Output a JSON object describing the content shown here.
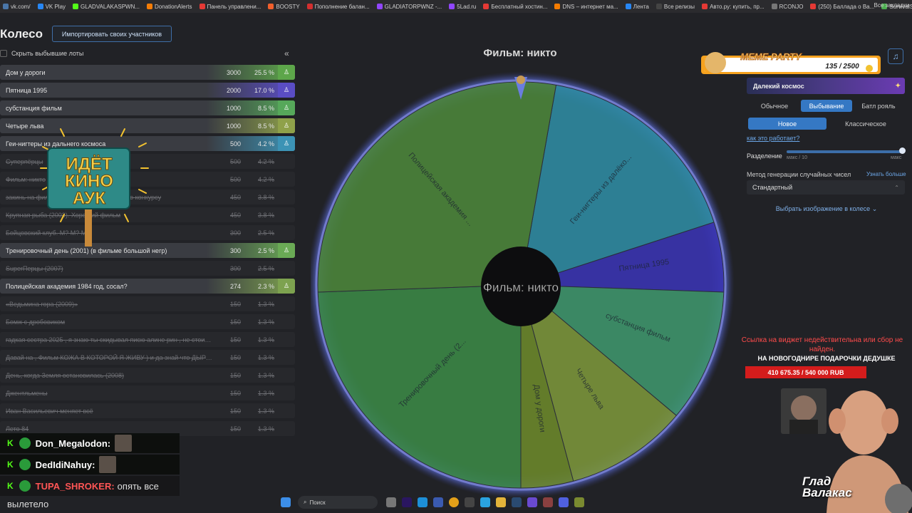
{
  "bookmarks": {
    "items": [
      {
        "label": "vk.com/",
        "color": "#4a76a8"
      },
      {
        "label": "VK Play",
        "color": "#2787f5"
      },
      {
        "label": "GLADVALAKASPWN...",
        "color": "#53fc18"
      },
      {
        "label": "DonationAlerts",
        "color": "#f57d07"
      },
      {
        "label": "Панель управлени...",
        "color": "#e53935"
      },
      {
        "label": "BOOSTY",
        "color": "#f15f2c"
      },
      {
        "label": "Пополнение балан...",
        "color": "#d32f2f"
      },
      {
        "label": "GLADIATORPWNZ -...",
        "color": "#9146ff"
      },
      {
        "label": "5Lad.ru",
        "color": "#9146ff"
      },
      {
        "label": "Бесплатный хостин...",
        "color": "#e53935"
      },
      {
        "label": "DNS – интернет ма...",
        "color": "#f57c00"
      },
      {
        "label": "Лента",
        "color": "#2787f5"
      },
      {
        "label": "Все релизы",
        "color": "#444"
      },
      {
        "label": "Авто.ру: купить, пр...",
        "color": "#e53935"
      },
      {
        "label": "RCONJO",
        "color": "#777"
      },
      {
        "label": "(250) Баллада о Ва...",
        "color": "#e53935"
      },
      {
        "label": "SurvivalShop | Пане...",
        "color": "#4caf50"
      },
      {
        "label": "Глад Валакас RUST",
        "color": "#666"
      }
    ],
    "all_label": "Все закладки"
  },
  "header": {
    "title": "Колесо",
    "import_label": "Импортировать своих участников",
    "hide_label": "Скрыть выбывшие лоты",
    "collapse_icon": "«"
  },
  "lots": [
    {
      "name": "Дом у дороги",
      "amount": "3000",
      "pct": "25.5 %",
      "color": "#5da64a",
      "share": 0.255,
      "out": false
    },
    {
      "name": "Пятница 1995",
      "amount": "2000",
      "pct": "17.0 %",
      "color": "#5a4dc4",
      "share": 0.17,
      "out": false
    },
    {
      "name": "субстанция фильм",
      "amount": "1000",
      "pct": "8.5 %",
      "color": "#56a85a",
      "share": 0.085,
      "out": false
    },
    {
      "name": "Четыре льва",
      "amount": "1000",
      "pct": "8.5 %",
      "color": "#8fa14a",
      "share": 0.085,
      "out": false
    },
    {
      "name": "Геи-нигтеры из дальнего космоса",
      "amount": "500",
      "pct": "4.2 %",
      "color": "#3c93b5",
      "share": 0.042,
      "out": false
    },
    {
      "name": "Суперпёрцы",
      "amount": "500",
      "pct": "4.2 %",
      "color": "",
      "share": 0,
      "out": true
    },
    {
      "name": "Фильм: никто",
      "amount": "500",
      "pct": "4.2 %",
      "color": "",
      "share": 0,
      "out": true
    },
    {
      "name": "закинь на фильм похороненный заживо по конкурсу",
      "amount": "450",
      "pct": "3.8 %",
      "color": "",
      "share": 0,
      "out": true
    },
    {
      "name": "Крупная рыба (2003). Хороший фильм",
      "amount": "450",
      "pct": "3.8 %",
      "color": "",
      "share": 0,
      "out": true
    },
    {
      "name": "Бойцовский клуб. М? М? М?",
      "amount": "300",
      "pct": "2.5 %",
      "color": "",
      "share": 0,
      "out": true
    },
    {
      "name": "Тренировочный день (2001) (в фильме большой негр)",
      "amount": "300",
      "pct": "2.5 %",
      "color": "#6aaa55",
      "share": 0.025,
      "out": false
    },
    {
      "name": "SuperПерцы (2007)",
      "amount": "300",
      "pct": "2.5 %",
      "color": "",
      "share": 0,
      "out": true
    },
    {
      "name": "Полицейская академия 1984 год, сосал?",
      "amount": "274",
      "pct": "2.3 %",
      "color": "#7da24f",
      "share": 0.023,
      "out": false
    },
    {
      "name": "«Ведьмина гора (2009)»",
      "amount": "150",
      "pct": "1.3 %",
      "color": "",
      "share": 0,
      "out": true
    },
    {
      "name": "Бомж с дробовиком",
      "amount": "150",
      "pct": "1.3 %",
      "color": "",
      "share": 0,
      "out": true
    },
    {
      "name": "гадкая сестра 2025 , я знаю ты скидывал писю алине рин , не стоит так д...",
      "amount": "150",
      "pct": "1.3 %",
      "color": "",
      "share": 0,
      "out": true
    },
    {
      "name": "Давай на , Фильм КОЖА В КОТОРОЙ Я ЖИВУ ) и да знай что ДЫРОЧКА...",
      "amount": "150",
      "pct": "1.3 %",
      "color": "",
      "share": 0,
      "out": true
    },
    {
      "name": "День, когда Земля остановилась (2008)",
      "amount": "150",
      "pct": "1.3 %",
      "color": "",
      "share": 0,
      "out": true
    },
    {
      "name": "Джентльмены",
      "amount": "150",
      "pct": "1.3 %",
      "color": "",
      "share": 0,
      "out": true
    },
    {
      "name": "Иван Васильевич меняет всё",
      "amount": "150",
      "pct": "1.3 %",
      "color": "",
      "share": 0,
      "out": true
    },
    {
      "name": "Лето 84",
      "amount": "150",
      "pct": "1.3 %",
      "color": "",
      "share": 0,
      "out": true
    }
  ],
  "sign": {
    "lines": [
      "ИДЁТ",
      "КИНО",
      "АУК"
    ]
  },
  "wheel": {
    "title": "Фильм: никто",
    "center_label": "Фильм: никто",
    "segments": [
      {
        "label": "Геи-нигтеры из далёко...",
        "color": "#2f8fa8"
      },
      {
        "label": "Пятница 1995",
        "color": "#3b35b8"
      },
      {
        "label": "субстанция фильм",
        "color": "#3f9a70"
      },
      {
        "label": "Четыре льва",
        "color": "#7f9a3c"
      },
      {
        "label": "Дом у дороги",
        "color": "#6f8c2c"
      },
      {
        "label": "Тренировочный день (2...",
        "color": "#3c8c48"
      },
      {
        "label": "Полицейская академия ...",
        "color": "#4e8a3c"
      }
    ]
  },
  "overlay": {
    "meme_title": "MEME PARTY",
    "meme_progress": "135 / 2500",
    "meme_ratio": 0.054
  },
  "settings": {
    "theme_label": "Далекий космос",
    "modes": [
      "Обычное",
      "Выбывание",
      "Батл рояль"
    ],
    "mode_active": 1,
    "order": [
      "Новое",
      "Классическое"
    ],
    "order_active": 0,
    "how_label": "как это работает?",
    "split_label": "Разделение",
    "split_min": "макс / 10",
    "split_max": "макс",
    "rng_label": "Метод генерации случайных чисел",
    "rng_more": "Узнать больше",
    "rng_value": "Стандартный",
    "image_select": "Выбрать изображение в колесе"
  },
  "donation": {
    "error": "Ссылка на виджет недействительна или сбор не найден.",
    "goal_title": "НА НОВОГОДНИРЕ ПОДАРОЧКИ ДЕДУШКЕ",
    "goal_value": "410 675.35 / 540 000 RUB"
  },
  "cam": {
    "name_line1": "Глад",
    "name_line2": "Валакас"
  },
  "chat": [
    {
      "user": "Don_Megalodon:",
      "text": ""
    },
    {
      "user": "DedIdiNahuy:",
      "text": ""
    },
    {
      "user": "TUPA_SHROKER:",
      "text": "опять все"
    }
  ],
  "chat_tail": "вылетело",
  "taskbar": {
    "search": "Поиск"
  }
}
